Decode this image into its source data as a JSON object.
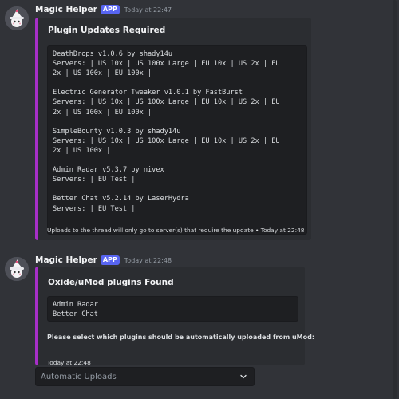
{
  "messages": [
    {
      "author": "Magic Helper",
      "badge": "APP",
      "timestamp": "Today at 22:47",
      "embed": {
        "title": "Plugin Updates Required",
        "code_lines": [
          "DeathDrops v1.0.6 by shady14u",
          "Servers: | US 10x | US 100x Large | EU 10x | US 2x | EU",
          "2x | US 100x | EU 100x |",
          "",
          "Electric Generator Tweaker v1.0.1 by FastBurst",
          "Servers: | US 10x | US 100x Large | EU 10x | US 2x | EU",
          "2x | US 100x | EU 100x |",
          "",
          "SimpleBounty v1.0.3 by shady14u",
          "Servers: | US 10x | US 100x Large | EU 10x | US 2x | EU",
          "2x | US 100x |",
          "",
          "Admin Radar v5.3.7 by nivex",
          "Servers: | EU Test |",
          "",
          "Better Chat v5.2.14 by LaserHydra",
          "Servers: | EU Test |"
        ],
        "footer": "Uploads to the thread will only go to server(s) that require the update • Today at 22:48"
      }
    },
    {
      "author": "Magic Helper",
      "badge": "APP",
      "timestamp": "Today at 22:48",
      "embed": {
        "title": "Oxide/uMod plugins Found",
        "code_lines": [
          "Admin Radar",
          "Better Chat"
        ],
        "description": "Please select which plugins should be automatically uploaded from uMod:",
        "footer": "Today at 22:48"
      },
      "select": {
        "placeholder": "Automatic Uploads"
      }
    }
  ],
  "colors": {
    "background": "#313338",
    "embed_background": "#2b2d31",
    "embed_accent": "#a72fc8",
    "code_background": "#1e1f22",
    "app_badge": "#5865f2"
  },
  "icons": {
    "avatar": "wizard-hat-avatar-icon",
    "dropdown": "chevron-down-icon"
  }
}
